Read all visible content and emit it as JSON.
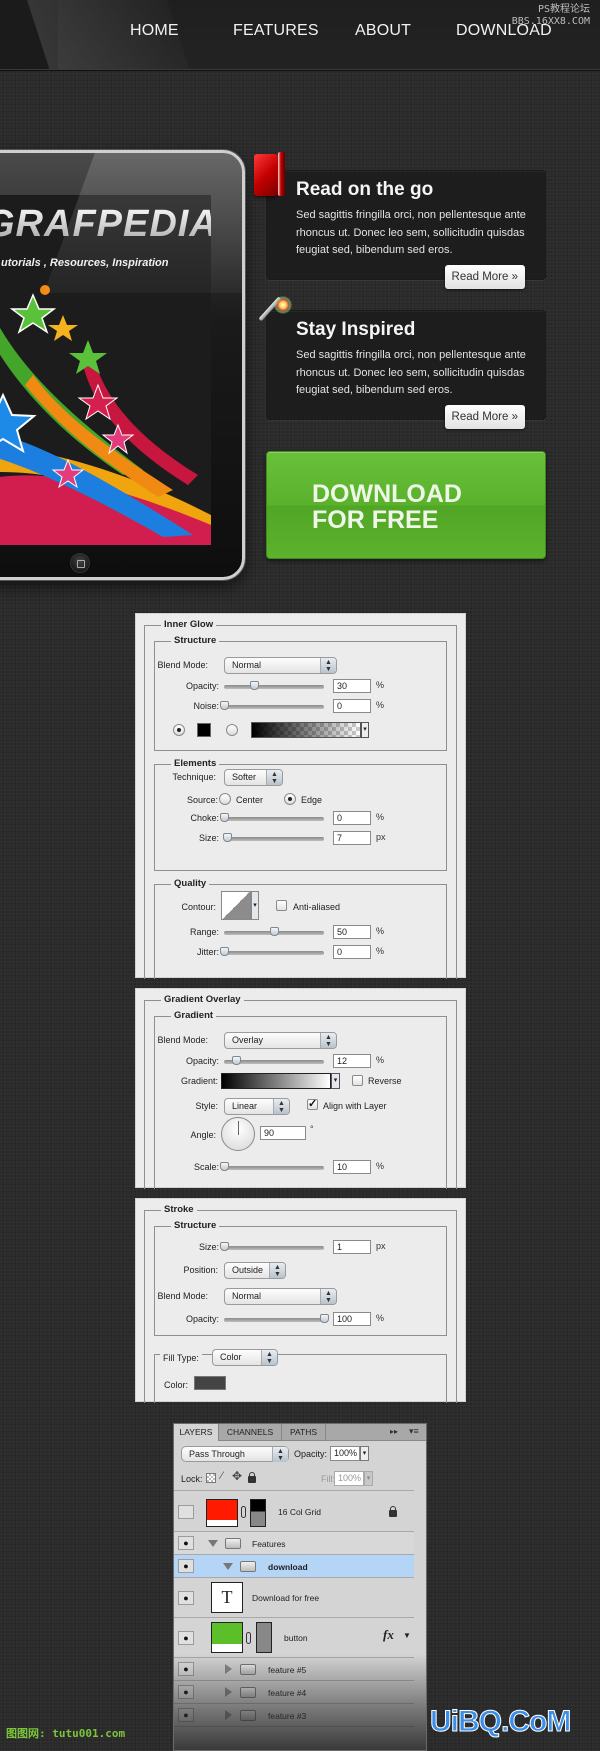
{
  "nav": {
    "items": [
      "HOME",
      "FEATURES",
      "ABOUT",
      "DOWNLOAD"
    ],
    "watermark": [
      "PS教程论坛",
      "BBS.16XX8.COM"
    ]
  },
  "tablet": {
    "brand": "GRAFPEDIA",
    "tagline": "utorials , Resources, Inspiration"
  },
  "features": [
    {
      "icon": "book-icon",
      "title": "Read on the go",
      "text": "Sed sagittis fringilla orci, non pellentesque ante rhoncus ut. Donec leo sem, sollicitudin quisdas feugiat sed, bibendum sed eros.",
      "button": "Read More »"
    },
    {
      "icon": "magic-wand-icon",
      "title": "Stay Inspired",
      "text": "Sed sagittis fringilla orci, non pellentesque ante rhoncus ut. Donec leo sem, sollicitudin quisdas feugiat sed, bibendum sed eros.",
      "button": "Read More »"
    }
  ],
  "download": {
    "line1": "DOWNLOAD",
    "line2": "FOR FREE",
    "color": "#5cb22d"
  },
  "inner_glow": {
    "title": "Inner Glow",
    "structure": {
      "title": "Structure",
      "blend_mode_label": "Blend Mode:",
      "blend_mode": "Normal",
      "opacity_label": "Opacity:",
      "opacity": "30",
      "opacity_unit": "%",
      "opacity_fraction": 0.3,
      "noise_label": "Noise:",
      "noise": "0",
      "noise_unit": "%",
      "noise_fraction": 0.0,
      "glow_color": "#000000"
    },
    "elements": {
      "title": "Elements",
      "technique_label": "Technique:",
      "technique": "Softer",
      "source_label": "Source:",
      "source_center": "Center",
      "source_edge": "Edge",
      "source_selected": "Edge",
      "choke_label": "Choke:",
      "choke": "0",
      "choke_unit": "%",
      "choke_fraction": 0.0,
      "size_label": "Size:",
      "size": "7",
      "size_unit": "px",
      "size_fraction": 0.03
    },
    "quality": {
      "title": "Quality",
      "contour_label": "Contour:",
      "anti_aliased_label": "Anti-aliased",
      "anti_aliased": false,
      "range_label": "Range:",
      "range": "50",
      "range_unit": "%",
      "range_fraction": 0.5,
      "jitter_label": "Jitter:",
      "jitter": "0",
      "jitter_unit": "%",
      "jitter_fraction": 0.0
    }
  },
  "gradient_overlay": {
    "title": "Gradient Overlay",
    "gradient_group": "Gradient",
    "blend_mode_label": "Blend Mode:",
    "blend_mode": "Overlay",
    "opacity_label": "Opacity:",
    "opacity": "12",
    "opacity_unit": "%",
    "opacity_fraction": 0.12,
    "gradient_label": "Gradient:",
    "reverse_label": "Reverse",
    "reverse": false,
    "style_label": "Style:",
    "style": "Linear",
    "align_label": "Align with Layer",
    "align": true,
    "angle_label": "Angle:",
    "angle": "90",
    "angle_unit": "°",
    "scale_label": "Scale:",
    "scale": "10",
    "scale_unit": "%",
    "scale_fraction": 0.0
  },
  "stroke": {
    "title": "Stroke",
    "structure_title": "Structure",
    "size_label": "Size:",
    "size": "1",
    "size_unit": "px",
    "size_fraction": 0.0,
    "position_label": "Position:",
    "position": "Outside",
    "blend_mode_label": "Blend Mode:",
    "blend_mode": "Normal",
    "opacity_label": "Opacity:",
    "opacity": "100",
    "opacity_unit": "%",
    "opacity_fraction": 1.0,
    "fill_type_label": "Fill Type:",
    "fill_type": "Color",
    "color_label": "Color:",
    "color": "#444444"
  },
  "layers_panel": {
    "tabs": [
      "LAYERS",
      "CHANNELS",
      "PATHS"
    ],
    "blend_mode": "Pass Through",
    "opacity_label": "Opacity:",
    "opacity": "100%",
    "lock_label": "Lock:",
    "fill_label": "Fill:",
    "fill": "100%",
    "layers": [
      {
        "name": "16 Col Grid",
        "visible": false,
        "locked": true,
        "color": "#ff1a00"
      },
      {
        "name": "Features",
        "visible": true,
        "type": "group",
        "expanded": true
      },
      {
        "name": "download",
        "visible": true,
        "type": "group",
        "expanded": true,
        "selected": true
      },
      {
        "name": "Download  for free",
        "visible": true,
        "type": "text"
      },
      {
        "name": "button",
        "visible": true,
        "color": "#5cbf2a",
        "fx": "fx"
      },
      {
        "name": "feature #5",
        "visible": true,
        "type": "group"
      },
      {
        "name": "feature #4",
        "visible": true,
        "type": "group"
      },
      {
        "name": "feature #3",
        "visible": true,
        "type": "group"
      }
    ]
  },
  "footer": {
    "watermark_left": "图图网: tutu001.com",
    "watermark_right": "UiBQ.CoM"
  }
}
